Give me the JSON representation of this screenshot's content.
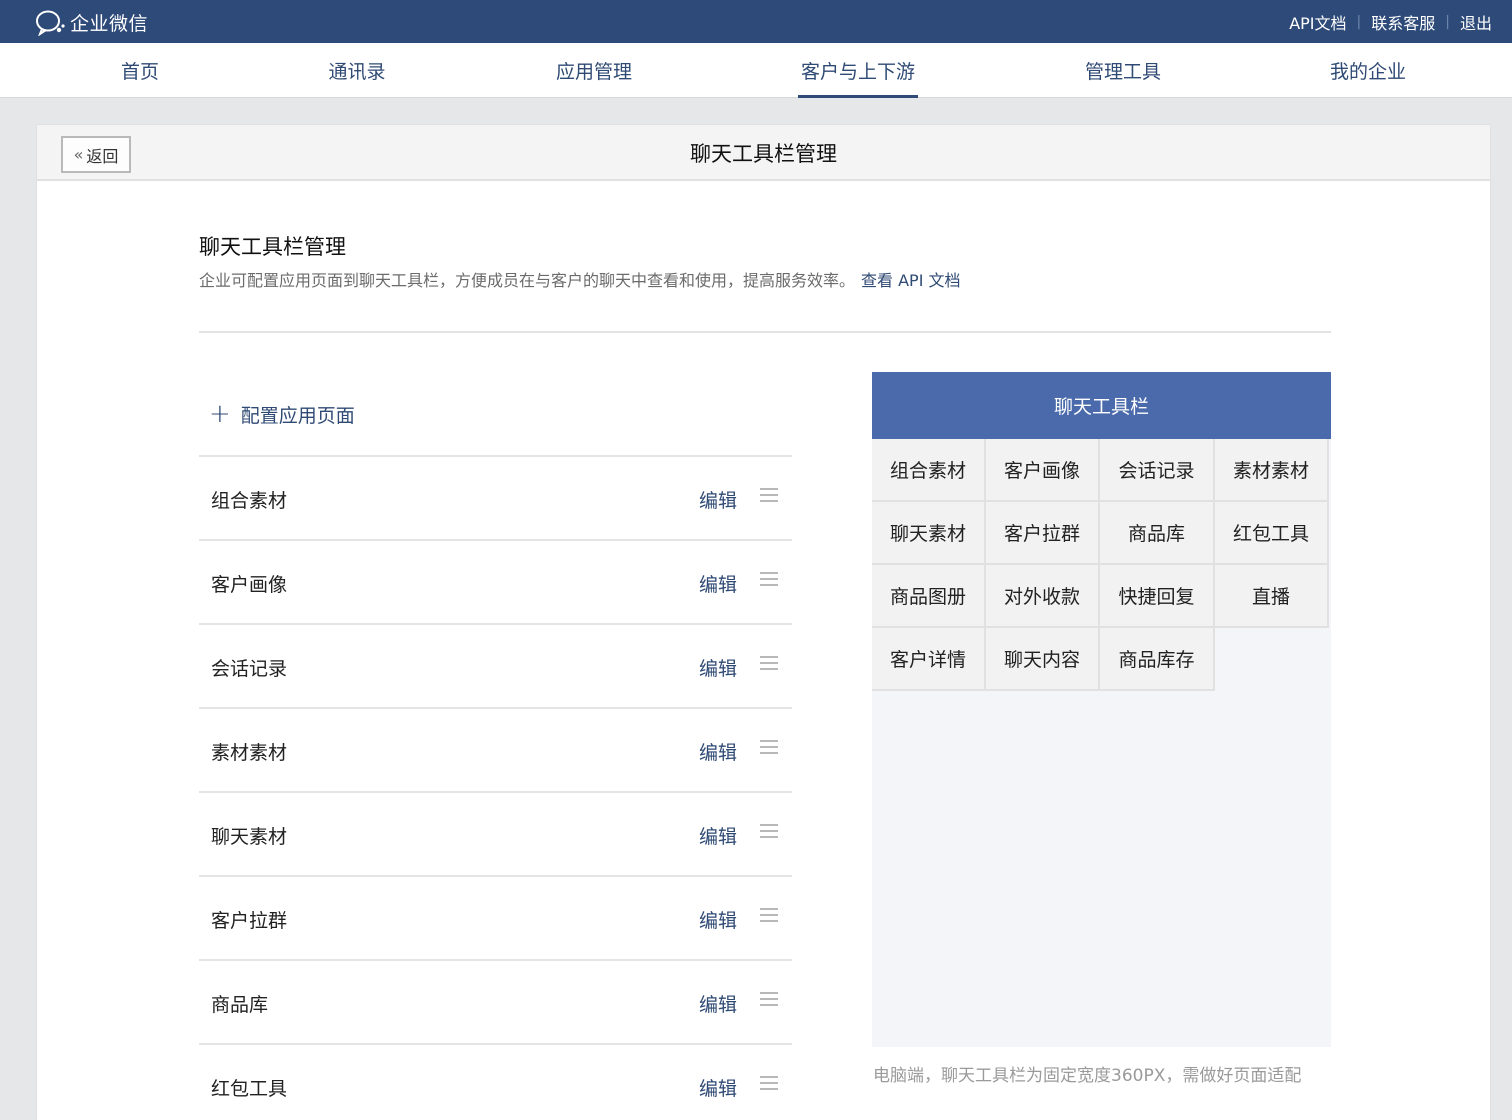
{
  "topbar": {
    "logo_text": "企业微信",
    "links": [
      "API文档",
      "联系客服",
      "退出"
    ]
  },
  "nav": {
    "items": [
      "首页",
      "通讯录",
      "应用管理",
      "客户与上下游",
      "管理工具",
      "我的企业"
    ],
    "active": "客户与上下游"
  },
  "page": {
    "back_label": "返回",
    "header_title": "聊天工具栏管理",
    "section_title": "聊天工具栏管理",
    "section_desc": "企业可配置应用页面到聊天工具栏，方便成员在与客户的聊天中查看和使用，提高服务效率。",
    "api_link": "查看 API 文档",
    "add_label": "配置应用页面"
  },
  "list": {
    "edit_label": "编辑",
    "items": [
      "组合素材",
      "客户画像",
      "会话记录",
      "素材素材",
      "聊天素材",
      "客户拉群",
      "商品库",
      "红包工具"
    ]
  },
  "preview": {
    "title": "聊天工具栏",
    "tools": [
      "组合素材",
      "客户画像",
      "会话记录",
      "素材素材",
      "聊天素材",
      "客户拉群",
      "商品库",
      "红包工具",
      "商品图册",
      "对外收款",
      "快捷回复",
      "直播",
      "客户详情",
      "聊天内容",
      "商品库存"
    ],
    "note": "电脑端，聊天工具栏为固定宽度360PX，需做好页面适配"
  },
  "colors": {
    "topbar": "#2e4a78",
    "accent": "#2f4a74",
    "preview_header": "#4a6aab"
  }
}
